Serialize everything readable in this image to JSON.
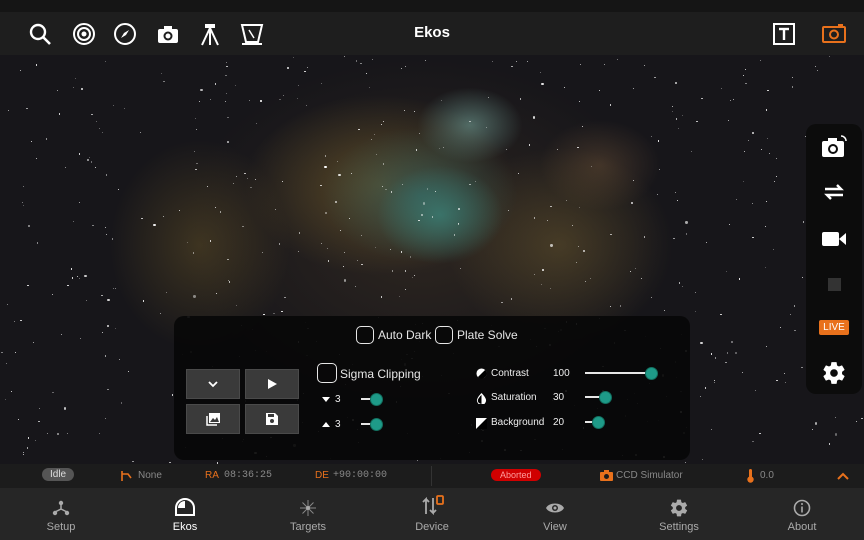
{
  "app": {
    "title": "Ekos"
  },
  "colors": {
    "accent": "#e8711c",
    "teal": "#1e9a88",
    "aborted": "#d00000"
  },
  "toolbar": {
    "left_icons": [
      "search-icon",
      "target-icon",
      "compass-icon",
      "camera-icon",
      "tripod-icon",
      "flat-panel-icon"
    ],
    "right_icons": [
      "text-frame-icon",
      "camera-frame-icon"
    ]
  },
  "capture_panel": {
    "live_label": "LIVE"
  },
  "overlay": {
    "auto_dark": "Auto Dark",
    "plate_solve": "Plate Solve",
    "sigma_clipping": "Sigma Clipping",
    "sigma_low": "3",
    "sigma_high": "3",
    "contrast_label": "Contrast",
    "contrast_value": "100",
    "saturation_label": "Saturation",
    "saturation_value": "30",
    "background_label": "Background",
    "background_value": "20",
    "slider_levels": {
      "contrast": 1.0,
      "saturation": 0.3,
      "background": 0.2
    }
  },
  "status": {
    "state": "Idle",
    "mount": "None",
    "ra_label": "RA",
    "ra_value": "08:36:25",
    "de_label": "DE",
    "de_value": "+90:00:00",
    "capture_state": "Aborted",
    "camera": "CCD Simulator",
    "temperature": "0.0"
  },
  "nav": [
    {
      "label": "Setup",
      "icon": "setup-icon"
    },
    {
      "label": "Ekos",
      "icon": "ekos-icon",
      "active": true
    },
    {
      "label": "Targets",
      "icon": "targets-icon"
    },
    {
      "label": "Device",
      "icon": "device-icon"
    },
    {
      "label": "View",
      "icon": "eye-icon"
    },
    {
      "label": "Settings",
      "icon": "gear-icon"
    },
    {
      "label": "About",
      "icon": "info-icon"
    }
  ]
}
